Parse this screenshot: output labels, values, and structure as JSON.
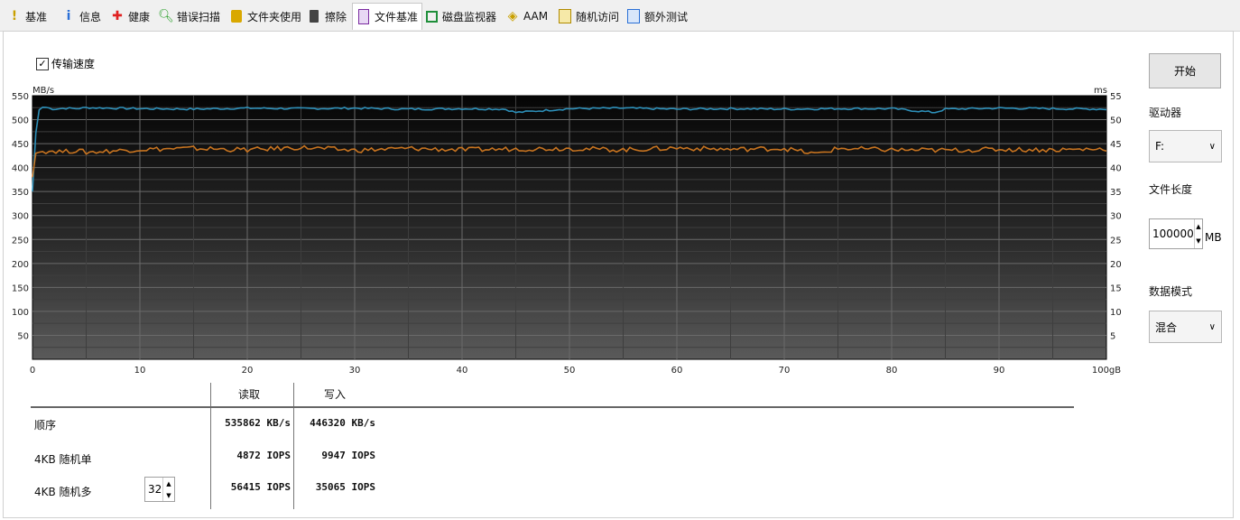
{
  "tabs": [
    {
      "label": "基准",
      "icon": "exclamation-icon",
      "color": "#c9a000"
    },
    {
      "label": "信息",
      "icon": "info-icon",
      "color": "#2a6fd6"
    },
    {
      "label": "健康",
      "icon": "red-cross-icon",
      "color": "#e02020"
    },
    {
      "label": "错误扫描",
      "icon": "magnifier-icon",
      "color": "#2aa02a"
    },
    {
      "label": "文件夹使用",
      "icon": "folder-icon",
      "color": "#d9a800"
    },
    {
      "label": "擦除",
      "icon": "trash-icon",
      "color": "#444444"
    },
    {
      "label": "文件基准",
      "icon": "file-benchmark-icon",
      "color": "#7a2aa0",
      "active": true
    },
    {
      "label": "磁盘监视器",
      "icon": "monitor-icon",
      "color": "#1f8f3a"
    },
    {
      "label": "AAM",
      "icon": "speaker-icon",
      "color": "#c9a000"
    },
    {
      "label": "随机访问",
      "icon": "random-access-icon",
      "color": "#d9a800"
    },
    {
      "label": "额外测试",
      "icon": "extra-tests-icon",
      "color": "#2a6fd6"
    }
  ],
  "transfer_speed_checkbox": {
    "label": "传输速度",
    "checked": true
  },
  "chart_data": {
    "type": "line",
    "ylabel_left": "MB/s",
    "ylabel_right": "ms",
    "xlabel": "gB",
    "ylim_left": [
      0,
      550
    ],
    "ylim_right": [
      0,
      55
    ],
    "xlim": [
      0,
      100
    ],
    "y_ticks_left": [
      50,
      100,
      150,
      200,
      250,
      300,
      350,
      400,
      450,
      500,
      550
    ],
    "y_ticks_right": [
      5,
      10,
      15,
      20,
      25,
      30,
      35,
      40,
      45,
      50,
      55
    ],
    "x_ticks": [
      0,
      10,
      20,
      30,
      40,
      50,
      60,
      70,
      80,
      90,
      100
    ],
    "grid": true,
    "series": [
      {
        "color": "#2d8fb8",
        "x": [
          0,
          0.3,
          0.6,
          1,
          2,
          3,
          4,
          5,
          10,
          15,
          20,
          25,
          30,
          35,
          40,
          44,
          45,
          50,
          55,
          60,
          65,
          70,
          75,
          80,
          84,
          85,
          90,
          95,
          100
        ],
        "y": [
          350,
          470,
          520,
          527,
          522,
          524,
          523,
          525,
          523,
          522,
          524,
          523,
          524,
          522,
          523,
          522,
          515,
          523,
          524,
          522,
          523,
          522,
          523,
          523,
          515,
          522,
          524,
          523,
          522
        ]
      },
      {
        "color": "#c87420",
        "x": [
          0,
          0.3,
          0.6,
          1,
          2,
          3,
          4,
          5,
          10,
          15,
          20,
          25,
          30,
          35,
          40,
          45,
          50,
          55,
          60,
          65,
          70,
          73,
          75,
          80,
          85,
          90,
          95,
          100
        ],
        "y": [
          380,
          430,
          432,
          434,
          435,
          433,
          436,
          432,
          438,
          440,
          437,
          442,
          436,
          440,
          437,
          439,
          440,
          437,
          441,
          438,
          440,
          428,
          440,
          437,
          436,
          438,
          437,
          439
        ]
      }
    ]
  },
  "results": {
    "col_read": "读取",
    "col_write": "写入",
    "rows": [
      {
        "label": "顺序",
        "read": "535862 KB/s",
        "write": "446320 KB/s"
      },
      {
        "label": "4KB 随机单",
        "read": "4872 IOPS",
        "write": "9947 IOPS"
      },
      {
        "label": "4KB 随机多",
        "read": "56415 IOPS",
        "write": "35065 IOPS"
      }
    ],
    "queue_depth": "32"
  },
  "controls": {
    "start_label": "开始",
    "drive_label": "驱动器",
    "drive_value": "F:",
    "file_length_label": "文件长度",
    "file_length_value": "100000",
    "file_length_unit": "MB",
    "data_mode_label": "数据模式",
    "data_mode_value": "混合"
  }
}
